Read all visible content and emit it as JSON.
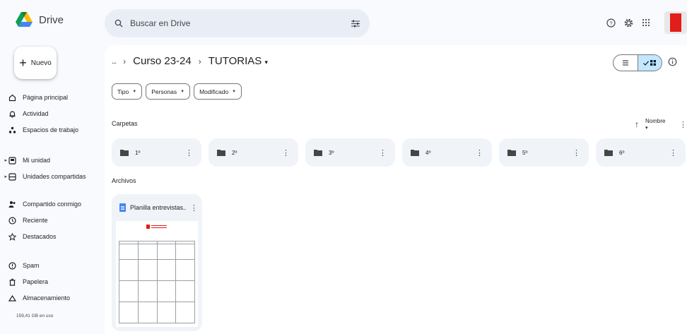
{
  "app": {
    "name": "Drive"
  },
  "search": {
    "placeholder": "Buscar en Drive"
  },
  "sidebar": {
    "new_label": "Nuevo",
    "items": [
      {
        "label": "Página principal",
        "icon": "home-icon"
      },
      {
        "label": "Actividad",
        "icon": "bell-icon"
      },
      {
        "label": "Espacios de trabajo",
        "icon": "workspaces-icon"
      },
      {
        "label": "Mi unidad",
        "icon": "my-drive-icon"
      },
      {
        "label": "Unidades compartidas",
        "icon": "shared-drives-icon"
      },
      {
        "label": "Compartido conmigo",
        "icon": "people-icon"
      },
      {
        "label": "Reciente",
        "icon": "clock-icon"
      },
      {
        "label": "Destacados",
        "icon": "star-icon"
      },
      {
        "label": "Spam",
        "icon": "spam-icon"
      },
      {
        "label": "Papelera",
        "icon": "trash-icon"
      },
      {
        "label": "Almacenamiento",
        "icon": "cloud-icon"
      }
    ],
    "storage_text": "159,41 GB en uso"
  },
  "breadcrumb": {
    "ellipsis": "...",
    "parent": "Curso 23-24",
    "current": "TUTORIAS"
  },
  "filters": [
    "Tipo",
    "Personas",
    "Modificado"
  ],
  "sections": {
    "folders": "Carpetas",
    "files": "Archivos"
  },
  "sort": {
    "label": "Nombre"
  },
  "folders": [
    "1º",
    "2º",
    "3º",
    "4º",
    "5º",
    "6º"
  ],
  "files": [
    {
      "name": "Planilla entrevistas..."
    }
  ],
  "colors": {
    "background": "#f8fafd",
    "search_bg": "#e9eef6",
    "card_bg": "#f0f4f9",
    "active_toggle": "#c2e7ff",
    "doc_blue": "#4285f4",
    "brand_red": "#e31d1a"
  }
}
